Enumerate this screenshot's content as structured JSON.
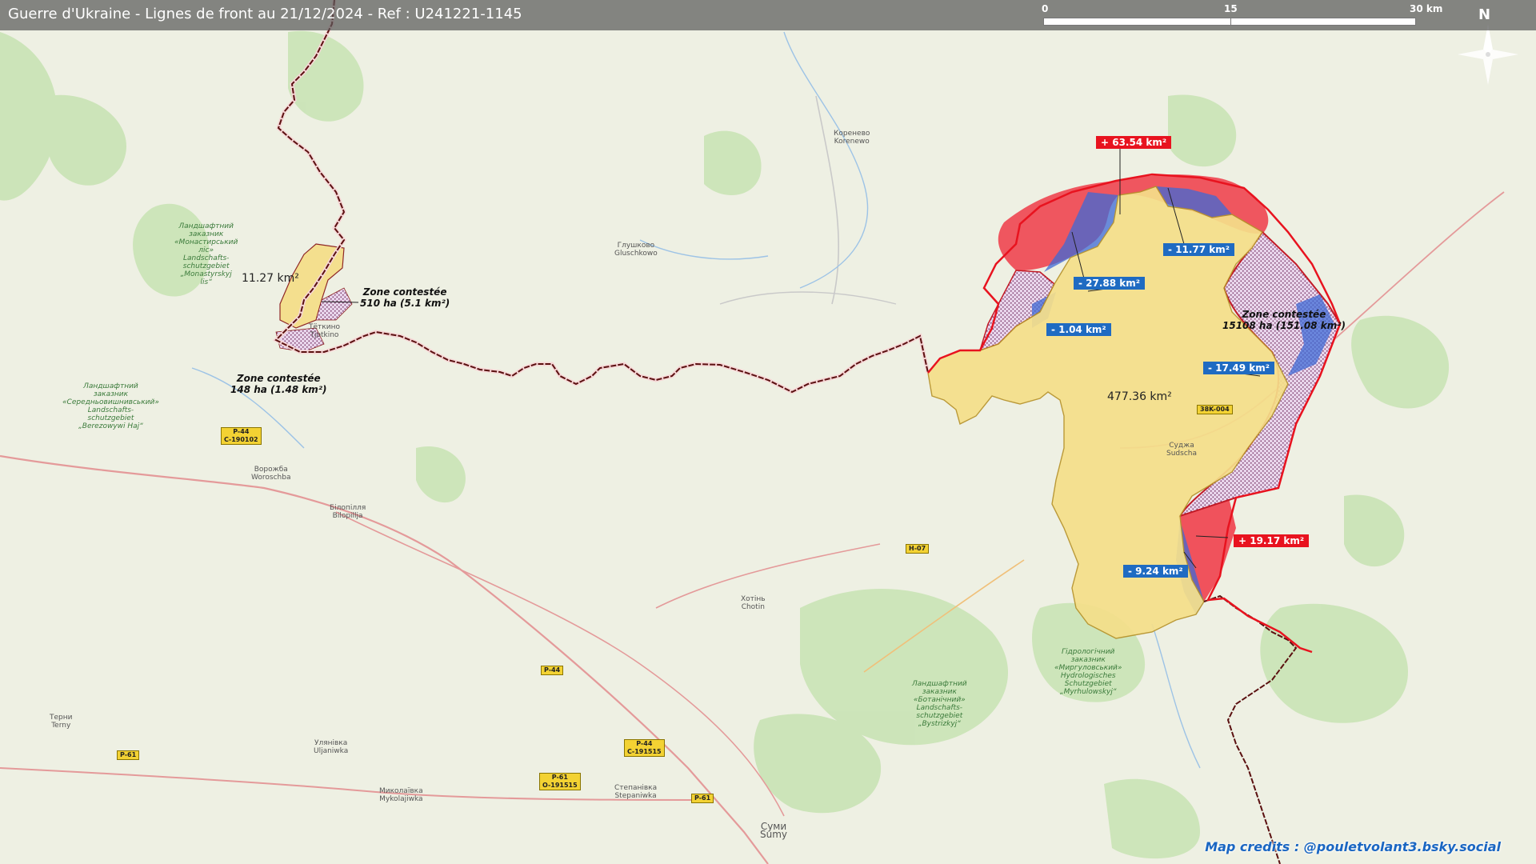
{
  "title": "Guerre d'Ukraine - Lignes de front au 21/12/2024 - Ref : U241221-1145",
  "scale": {
    "labels": [
      "0",
      "15",
      "30 km"
    ]
  },
  "north_label": "N",
  "credits": "Map credits : @pouletvolant3.bsky.social",
  "colors": {
    "occupied": "#f5df8a",
    "gain": "#ef2030",
    "loss": "#3d6ad6",
    "border": "#7a1b1b"
  },
  "tags": {
    "gain_north": "+ 63.54 km²",
    "loss_north_east": "- 11.77 km²",
    "loss_north_west": "- 27.88 km²",
    "loss_west": "- 1.04 km²",
    "loss_east": "- 17.49 km²",
    "gain_south_east": "+ 19.17 km²",
    "loss_south": "- 9.24 km²"
  },
  "zones": {
    "west_area": "11.27 km²",
    "west_contested_1_title": "Zone contestée",
    "west_contested_1_value": "510 ha (5.1 km²)",
    "west_contested_2_title": "Zone contestée",
    "west_contested_2_value": "148 ha (1.48 km²)",
    "east_contested_title": "Zone contestée",
    "east_contested_value": "15108 ha (151.08 km²)",
    "main_area": "477.36 km²"
  },
  "towns": {
    "korenevo": [
      "Коренево",
      "Korenewo"
    ],
    "glushkovo": [
      "Глушково",
      "Gluschkowo"
    ],
    "tetkino": [
      "Тёткино",
      "Tjotkino"
    ],
    "sudzha": [
      "Суджа",
      "Sudscha"
    ],
    "vorozhba": [
      "Ворожба",
      "Woroschba"
    ],
    "bilopillia": [
      "Білопілля",
      "Bilopillja"
    ],
    "khotin": [
      "Хотінь",
      "Chotin"
    ],
    "terny": [
      "Терни",
      "Terny"
    ],
    "ulianivka": [
      "Улянівка",
      "Uljaniwka"
    ],
    "mykolaivka": [
      "Миколаївка",
      "Mykolajiwka"
    ],
    "stepanivka": [
      "Степанівка",
      "Stepaniwka"
    ],
    "sumy": [
      "Суми",
      "Sumy"
    ]
  },
  "reserves": {
    "west": [
      "Ландшафтний",
      "заказник",
      "«Монастирський",
      "ліс»",
      "Landschafts-",
      "schutzgebiet",
      "„Monastyrskyj",
      "lis“"
    ],
    "south_west": [
      "Ландшафтний",
      "заказник",
      "«Середньовишнивський»",
      "Landschafts-",
      "schutzgebiet",
      "„Berezowywi Haj“"
    ],
    "south_1": [
      "Гідрологічний",
      "заказник",
      "«Миргуловський»",
      "Hydrologisches",
      "Schutzgebiet",
      "„Myrhulowskyj“"
    ],
    "south_2": [
      "Ландшафтний",
      "заказник",
      "«Ботанічний»",
      "Landschafts-",
      "schutzgebiet",
      "„Bystrizkyj“"
    ]
  },
  "shields": {
    "p44_a": [
      "P-44",
      "С-190102"
    ],
    "h07": [
      "H-07"
    ],
    "p44_b": [
      "P-44"
    ],
    "p44_c": [
      "P-44",
      "С-191515"
    ],
    "p61_a": [
      "P-61"
    ],
    "p61_b": [
      "P-61",
      "O-191515"
    ],
    "p61_c": [
      "P-61"
    ],
    "road_38k": [
      "38K-004"
    ]
  }
}
